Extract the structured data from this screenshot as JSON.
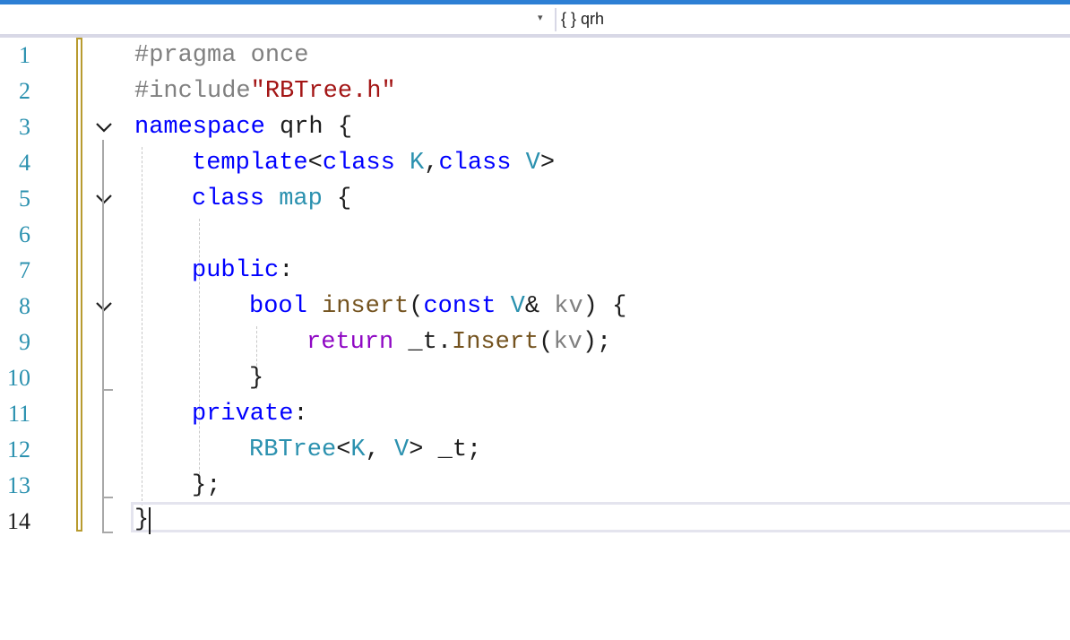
{
  "navigation": {
    "scope": "{ } qrh",
    "dropdown_glyph": "▾"
  },
  "line_numbers": [
    "1",
    "2",
    "3",
    "4",
    "5",
    "6",
    "7",
    "8",
    "9",
    "10",
    "11",
    "12",
    "13",
    "14"
  ],
  "active_line": 14,
  "code": {
    "l1": {
      "directive": "#pragma once"
    },
    "l2": {
      "directive": "#include",
      "file": "\"RBTree.h\""
    },
    "l3": {
      "kw": "namespace",
      "name": " qrh {"
    },
    "l4": {
      "kw1": "template",
      "lt": "<",
      "kw2": "class",
      "t1": " K",
      "comma": ",",
      "kw3": "class",
      "t2": " V",
      "gt": ">"
    },
    "l5": {
      "kw": "class",
      "t": " map",
      "brace": " {"
    },
    "l6": {},
    "l7": {
      "kw": "public",
      "colon": ":"
    },
    "l8": {
      "kw1": "bool",
      "fn": " insert",
      "open": "(",
      "kw2": "const",
      "t": " V",
      "amp": "& ",
      "param": "kv",
      "close": ") {"
    },
    "l9": {
      "kw": "return",
      "member": " _t.",
      "fn": "Insert",
      "open": "(",
      "param": "kv",
      "close": ");"
    },
    "l10": {
      "brace": "}"
    },
    "l11": {
      "kw": "private",
      "colon": ":"
    },
    "l12": {
      "t1": "RBTree",
      "lt": "<",
      "t2": "K",
      "comma": ", ",
      "t3": "V",
      "gt": "> ",
      "member": "_t;"
    },
    "l13": {
      "brace": "};"
    },
    "l14": {
      "brace": "}"
    }
  },
  "colors": {
    "keyword": "#0000ff",
    "control": "#8f08c4",
    "type": "#2b91af",
    "function": "#74531f",
    "string": "#a31515",
    "preprocessor": "#808080",
    "parameter": "#808080",
    "change_bar": "#b89b2f",
    "title_accent": "#2d7fd4"
  },
  "fold_icons": [
    "chevron-down-icon",
    "chevron-down-icon",
    "chevron-down-icon"
  ]
}
